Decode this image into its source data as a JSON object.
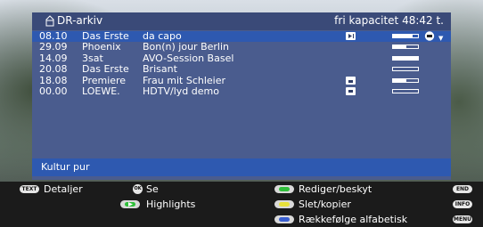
{
  "header": {
    "folder_icon": "folder-icon",
    "title": "DR-arkiv",
    "capacity": "fri kapacitet 48:42 t."
  },
  "recordings": [
    {
      "time": "08.10",
      "channel": "Das Erste",
      "title": "da capo",
      "icon": "timeshift-icon",
      "progress": 0.8,
      "selected": true
    },
    {
      "time": "29.09",
      "channel": "Phoenix",
      "title": "Bon(n) jour Berlin",
      "icon": "",
      "progress": 0.55,
      "selected": false
    },
    {
      "time": "14.09",
      "channel": "3sat",
      "title": "AVO-Session Basel",
      "icon": "",
      "progress": 1.0,
      "selected": false
    },
    {
      "time": "20.08",
      "channel": "Das Erste",
      "title": "Brisant",
      "icon": "",
      "progress": 0.0,
      "selected": false
    },
    {
      "time": "18.08",
      "channel": "Premiere",
      "title": "Frau mit Schleier",
      "icon": "lock-icon",
      "progress": 0.55,
      "selected": false
    },
    {
      "time": "00.00",
      "channel": "LOEWE.",
      "title": "HDTV/lyd demo",
      "icon": "protected-icon",
      "progress": 0.0,
      "selected": false
    }
  ],
  "footer": {
    "info_text": "Kultur pur"
  },
  "legend": {
    "text_key": "TEXT",
    "details": "Detaljer",
    "ok_key": "OK",
    "watch": "Se",
    "highlights": "Highlights",
    "edit": "Rediger/beskyt",
    "delete": "Slet/kopier",
    "sort": "Rækkefølge alfabetisk",
    "end_key": "END",
    "info_key": "INFO",
    "menu_key": "MENU"
  },
  "colors": {
    "panel": "#4a5c8e",
    "selection": "#2e59b0",
    "green": "#2fbf3a",
    "yellow": "#e8e23a",
    "blue": "#3a5fd0"
  }
}
